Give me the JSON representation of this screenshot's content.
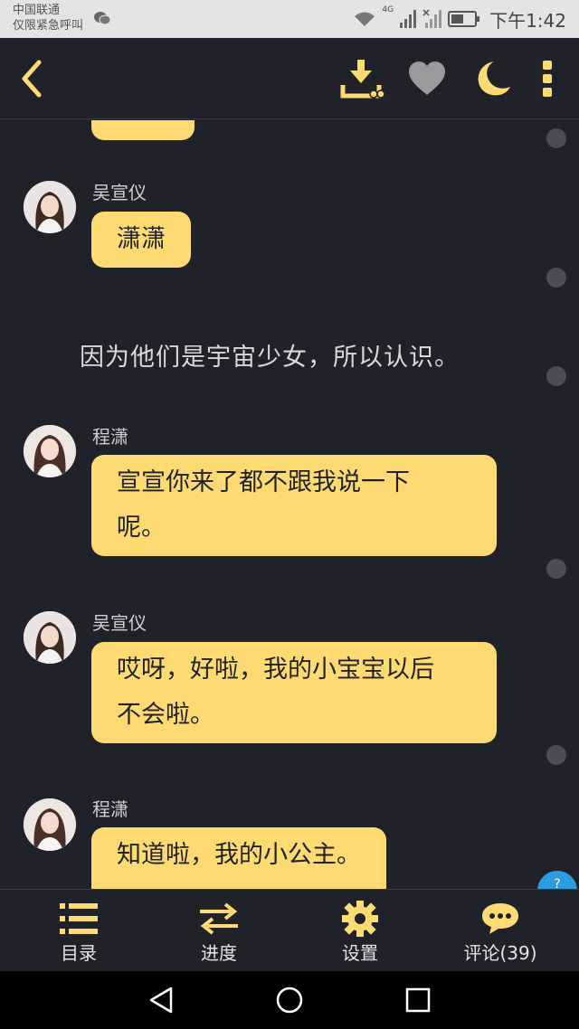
{
  "status_bar": {
    "carrier_line1": "中国联通",
    "carrier_line2": "仅限紧急呼叫",
    "network_label": "4G",
    "time": "下午1:42",
    "icons": [
      "wechat-icon",
      "wifi-icon",
      "signal-icon",
      "no-signal-icon",
      "battery-icon"
    ]
  },
  "toolbar": {
    "accent_color": "#fedb72",
    "icons": [
      "back-arrow-icon",
      "download-icon",
      "heart-icon",
      "night-mode-moon-icon",
      "more-vertical-icon"
    ]
  },
  "chat": {
    "bubble_color": "#fedb72",
    "messages": [
      {
        "sender": "吴宣仪",
        "text": "潇潇"
      },
      {
        "narration": "因为他们是宇宙少女，所以认识。"
      },
      {
        "sender": "程潇",
        "line1": "宣宣你来了都不跟我说一下",
        "line2": "呢。"
      },
      {
        "sender": "吴宣仪",
        "line1": "哎呀，好啦，我的小宝宝以后",
        "line2": "不会啦。"
      },
      {
        "sender": "程潇",
        "text": "知道啦，我的小公主。"
      }
    ]
  },
  "bottom_nav": {
    "items": [
      {
        "label": "目录",
        "icon": "list-icon"
      },
      {
        "label": "进度",
        "icon": "swap-arrows-icon"
      },
      {
        "label": "设置",
        "icon": "gear-icon"
      },
      {
        "label": "评论(39)",
        "icon": "comment-bubble-icon"
      }
    ]
  },
  "system_nav": {
    "icons": [
      "back-triangle-icon",
      "home-circle-icon",
      "recents-square-icon"
    ]
  }
}
